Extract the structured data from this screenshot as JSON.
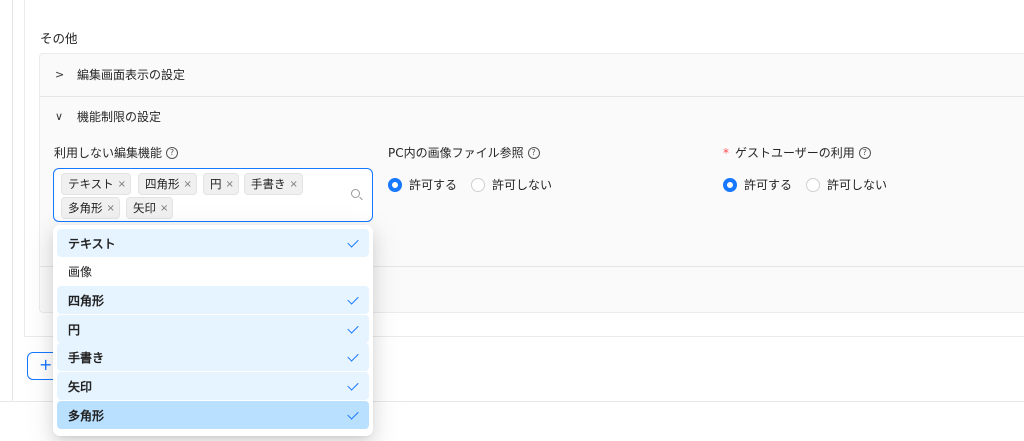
{
  "section": {
    "title": "その他"
  },
  "panels": [
    {
      "label": "編集画面表示の設定",
      "expanded": false
    },
    {
      "label": "機能制限の設定",
      "expanded": true
    }
  ],
  "fields": {
    "unused_features": {
      "label": "利用しない編集機能",
      "tags": [
        "テキスト",
        "四角形",
        "円",
        "手書き",
        "多角形",
        "矢印"
      ]
    },
    "pc_image_ref": {
      "label": "PC内の画像ファイル参照",
      "options": [
        "許可する",
        "許可しない"
      ],
      "selected": "許可する"
    },
    "guest_user": {
      "required_mark": "*",
      "label": "ゲストユーザーの利用",
      "options": [
        "許可する",
        "許可しない"
      ],
      "selected": "許可する"
    }
  },
  "dropdown": {
    "options": [
      {
        "label": "テキスト",
        "selected": true
      },
      {
        "label": "画像",
        "selected": false
      },
      {
        "label": "四角形",
        "selected": true
      },
      {
        "label": "円",
        "selected": true
      },
      {
        "label": "手書き",
        "selected": true
      },
      {
        "label": "矢印",
        "selected": true
      },
      {
        "label": "多角形",
        "selected": true,
        "active": true
      }
    ]
  },
  "add_button": {
    "label": "+"
  },
  "icons": {
    "help": "?",
    "tag_remove": "×",
    "chevron_right": ">",
    "chevron_down": "∨"
  },
  "colors": {
    "accent": "#1677ff",
    "selected_bg": "#e6f4ff",
    "active_bg": "#bae0ff",
    "required": "#ff4d4f"
  }
}
